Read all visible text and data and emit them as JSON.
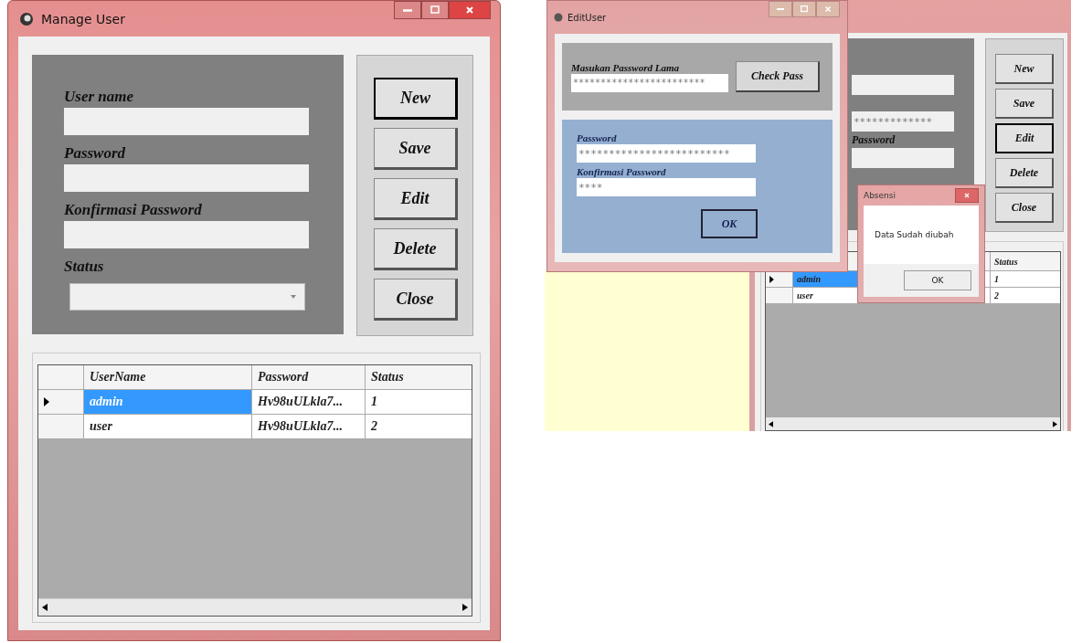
{
  "manage_user_window": {
    "title": "Manage User",
    "fields": [
      {
        "kind": "text",
        "label": "User name"
      },
      {
        "kind": "text",
        "label": "Password"
      },
      {
        "kind": "text",
        "label": "Konfirmasi Password"
      },
      {
        "kind": "dropdown",
        "label": "Status"
      }
    ],
    "buttons": [
      {
        "label": "New",
        "focused": true
      },
      {
        "label": "Save",
        "focused": false
      },
      {
        "label": "Edit",
        "focused": false
      },
      {
        "label": "Delete",
        "focused": false
      },
      {
        "label": "Close",
        "focused": false
      }
    ],
    "grid": {
      "columns": [
        "UserName",
        "Password",
        "Status"
      ],
      "rows": [
        {
          "cells": [
            "admin",
            "Hv98uULkla7...",
            "1"
          ],
          "selected": true
        },
        {
          "cells": [
            "user",
            "Hv98uULkla7...",
            "2"
          ],
          "selected": false
        }
      ]
    }
  },
  "second_screenshot": {
    "background_window": {
      "fields": [
        {
          "kind": "field"
        },
        {
          "kind": "field",
          "value": "*************"
        },
        {
          "kind": "label",
          "text": "Password"
        },
        {
          "kind": "field"
        }
      ],
      "buttons": [
        {
          "label": "New",
          "focused": false
        },
        {
          "label": "Save",
          "focused": false
        },
        {
          "label": "Edit",
          "focused": true
        },
        {
          "label": "Delete",
          "focused": false
        },
        {
          "label": "Close",
          "focused": false
        }
      ],
      "grid": {
        "status_heading": "Status",
        "rows": [
          {
            "name": "admin",
            "status": "1",
            "selected": true
          },
          {
            "name": "user",
            "status": "2",
            "selected": false
          }
        ]
      }
    },
    "edit_dialog": {
      "title": "EditUser",
      "old_password": {
        "label": "Masukan Password Lama",
        "value": "************************"
      },
      "check_button": "Check Pass",
      "new_password": {
        "label": "Password",
        "value": "*************************"
      },
      "confirm_password": {
        "label": "Konfirmasi Password",
        "value": "****"
      },
      "ok_button": "OK"
    },
    "message_box": {
      "title": "Absensi",
      "message": "Data Sudah diubah",
      "ok_button": "OK"
    }
  }
}
